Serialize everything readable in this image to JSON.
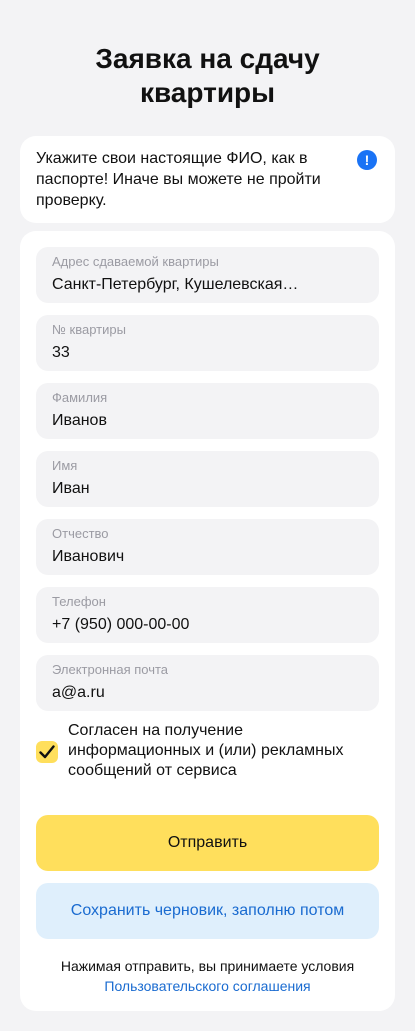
{
  "page": {
    "title_line1": "Заявка на сдачу",
    "title_line2": "квартиры"
  },
  "notice": {
    "text": "Укажите свои настоящие ФИО, как в паспорте! Иначе вы можете не пройти проверку.",
    "icon": "info-icon",
    "icon_glyph": "!",
    "icon_color": "#1a73f5"
  },
  "form": {
    "fields": [
      {
        "label": "Адрес сдаваемой квартиры",
        "value": "Санкт-Петербург, Кушелевская…"
      },
      {
        "label": "№ квартиры",
        "value": "33"
      },
      {
        "label": "Фамилия",
        "value": "Иванов"
      },
      {
        "label": "Имя",
        "value": "Иван"
      },
      {
        "label": "Отчество",
        "value": "Иванович"
      },
      {
        "label": "Телефон",
        "value": "+7 (950) 000-00-00"
      },
      {
        "label": "Электронная почта",
        "value": "a@a.ru"
      }
    ],
    "consent": {
      "checked": true,
      "text": "Согласен на получение информационных и (или) рекламных сообщений от сервиса"
    },
    "submit_label": "Отправить",
    "draft_label": "Сохранить черновик, заполню потом",
    "terms_text": "Нажимая отправить, вы принимаете условия",
    "terms_link": "Пользовательского соглашения"
  },
  "colors": {
    "accent_yellow": "#ffdf5c",
    "link_blue": "#1a6bd0",
    "draft_bg": "#dfeffc",
    "background": "#f3f3f5"
  }
}
